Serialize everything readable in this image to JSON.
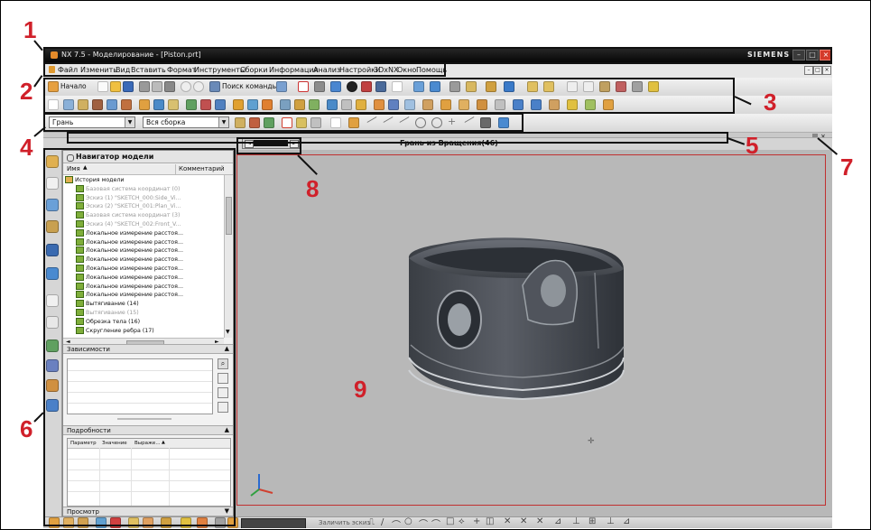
{
  "window": {
    "title": "NX 7.5 - Моделирование - [Piston.prt]",
    "brand": "SIEMENS",
    "controls": {
      "minimize": "–",
      "maximize": "□",
      "close": "×"
    }
  },
  "menu": {
    "items": [
      "Файл",
      "Изменить",
      "Вид",
      "Вставить",
      "Формат",
      "Инструменты",
      "Сборки",
      "Информация",
      "Анализ",
      "Настройки",
      "3DxNX",
      "Окно",
      "Помощь"
    ],
    "mdi_controls": [
      "–",
      "□",
      "×"
    ]
  },
  "toolbar": {
    "start_label": "Начало",
    "command_search": "Поиск команды"
  },
  "selection": {
    "filter": "Грань",
    "scope": "Вся сборка"
  },
  "status": {
    "message": "Грань из Вращения(46)"
  },
  "navigator": {
    "title": "Навигатор модели",
    "columns": [
      "Имя",
      "Комментарий"
    ],
    "rows": [
      {
        "label": "История модели",
        "dim": false
      },
      {
        "label": "Базовая система координат (0)",
        "dim": true
      },
      {
        "label": "Эскиз (1) \"SKETCH_000:Side_Vi...",
        "dim": true
      },
      {
        "label": "Эскиз (2) \"SKETCH_001:Plan_Vi...",
        "dim": true
      },
      {
        "label": "Базовая система координат (3)",
        "dim": true
      },
      {
        "label": "Эскиз (4) \"SKETCH_002:Front_V...",
        "dim": true
      },
      {
        "label": "Локальное измерение расстоя...",
        "dim": false
      },
      {
        "label": "Локальное измерение расстоя...",
        "dim": false
      },
      {
        "label": "Локальное измерение расстоя...",
        "dim": false
      },
      {
        "label": "Локальное измерение расстоя...",
        "dim": false
      },
      {
        "label": "Локальное измерение расстоя...",
        "dim": false
      },
      {
        "label": "Локальное измерение расстоя...",
        "dim": false
      },
      {
        "label": "Локальное измерение расстоя...",
        "dim": false
      },
      {
        "label": "Локальное измерение расстоя...",
        "dim": false
      },
      {
        "label": "Вытягивание (14)",
        "dim": false
      },
      {
        "label": "Вытягивание (15)",
        "dim": true
      },
      {
        "label": "Обрезка тела (16)",
        "dim": false
      },
      {
        "label": "Скругление ребра (17)",
        "dim": false
      }
    ],
    "dependencies_title": "Зависимости",
    "details_title": "Подробности",
    "details_columns": [
      "Параметр",
      "Значение",
      "Выраже..."
    ],
    "preview_title": "Просмотр"
  },
  "bottom": {
    "hint": "Заличить эскиз"
  },
  "callouts": [
    "1",
    "2",
    "3",
    "4",
    "5",
    "6",
    "7",
    "8",
    "9"
  ],
  "colors": {
    "callout": "#d0202a",
    "viewport": "#b8b8b8",
    "titlebar": "#0a0a0a",
    "piston": "#4a4e54"
  }
}
